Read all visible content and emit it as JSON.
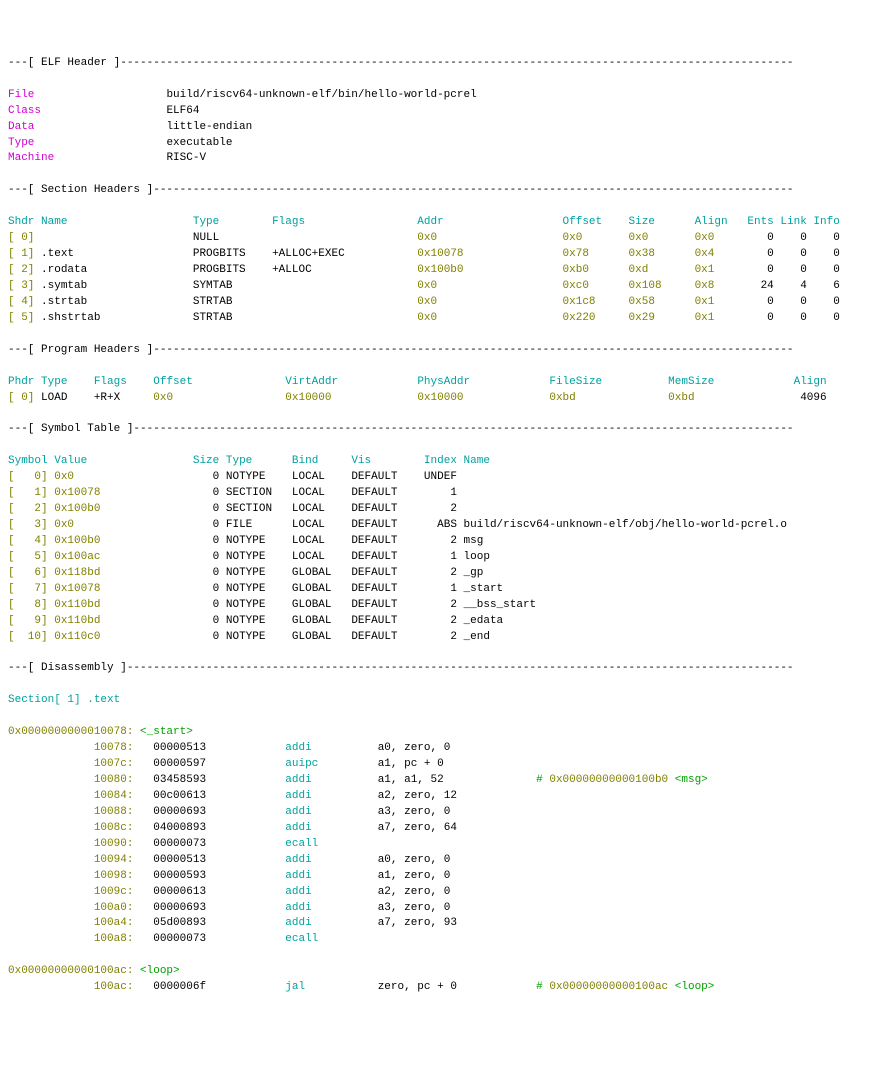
{
  "header_titles": {
    "elf": "---[ ELF Header ]------------------------------------------------------------------------------------------------------",
    "sections": "---[ Section Headers ]-------------------------------------------------------------------------------------------------",
    "programs": "---[ Program Headers ]-------------------------------------------------------------------------------------------------",
    "symbols": "---[ Symbol Table ]----------------------------------------------------------------------------------------------------",
    "disasm": "---[ Disassembly ]-----------------------------------------------------------------------------------------------------"
  },
  "elf": {
    "labels": {
      "file": "File",
      "class": "Class",
      "data": "Data",
      "type": "Type",
      "machine": "Machine"
    },
    "file": "build/riscv64-unknown-elf/bin/hello-world-pcrel",
    "class": "ELF64",
    "data": "little-endian",
    "type": "executable",
    "machine": "RISC-V"
  },
  "sections": {
    "cols": {
      "shdr": "Shdr",
      "name": "Name",
      "type": "Type",
      "flags": "Flags",
      "addr": "Addr",
      "offset": "Offset",
      "size": "Size",
      "align": "Align",
      "ents": "Ents",
      "link": "Link",
      "info": "Info"
    },
    "rows": [
      {
        "i": "[ 0]",
        "name": "",
        "type": "NULL",
        "flags": "",
        "addr": "0x0",
        "offset": "0x0",
        "size": "0x0",
        "align": "0x0",
        "ents": "0",
        "link": "0",
        "info": "0"
      },
      {
        "i": "[ 1]",
        "name": ".text",
        "type": "PROGBITS",
        "flags": "+ALLOC+EXEC",
        "addr": "0x10078",
        "offset": "0x78",
        "size": "0x38",
        "align": "0x4",
        "ents": "0",
        "link": "0",
        "info": "0"
      },
      {
        "i": "[ 2]",
        "name": ".rodata",
        "type": "PROGBITS",
        "flags": "+ALLOC",
        "addr": "0x100b0",
        "offset": "0xb0",
        "size": "0xd",
        "align": "0x1",
        "ents": "0",
        "link": "0",
        "info": "0"
      },
      {
        "i": "[ 3]",
        "name": ".symtab",
        "type": "SYMTAB",
        "flags": "",
        "addr": "0x0",
        "offset": "0xc0",
        "size": "0x108",
        "align": "0x8",
        "ents": "24",
        "link": "4",
        "info": "6"
      },
      {
        "i": "[ 4]",
        "name": ".strtab",
        "type": "STRTAB",
        "flags": "",
        "addr": "0x0",
        "offset": "0x1c8",
        "size": "0x58",
        "align": "0x1",
        "ents": "0",
        "link": "0",
        "info": "0"
      },
      {
        "i": "[ 5]",
        "name": ".shstrtab",
        "type": "STRTAB",
        "flags": "",
        "addr": "0x0",
        "offset": "0x220",
        "size": "0x29",
        "align": "0x1",
        "ents": "0",
        "link": "0",
        "info": "0"
      }
    ]
  },
  "programs": {
    "cols": {
      "phdr": "Phdr",
      "type": "Type",
      "flags": "Flags",
      "offset": "Offset",
      "vaddr": "VirtAddr",
      "paddr": "PhysAddr",
      "fsize": "FileSize",
      "msize": "MemSize",
      "align": "Align"
    },
    "rows": [
      {
        "i": "[ 0]",
        "type": "LOAD",
        "flags": "+R+X",
        "offset": "0x0",
        "vaddr": "0x10000",
        "paddr": "0x10000",
        "fsize": "0xbd",
        "msize": "0xbd",
        "align": "4096"
      }
    ]
  },
  "symbols": {
    "cols": {
      "symbol": "Symbol",
      "value": "Value",
      "size": "Size",
      "type": "Type",
      "bind": "Bind",
      "vis": "Vis",
      "index": "Index",
      "name": "Name"
    },
    "rows": [
      {
        "i": "[   0]",
        "value": "0x0",
        "size": "0",
        "type": "NOTYPE",
        "bind": "LOCAL",
        "vis": "DEFAULT",
        "index": "UNDEF",
        "name": ""
      },
      {
        "i": "[   1]",
        "value": "0x10078",
        "size": "0",
        "type": "SECTION",
        "bind": "LOCAL",
        "vis": "DEFAULT",
        "index": "1",
        "name": ""
      },
      {
        "i": "[   2]",
        "value": "0x100b0",
        "size": "0",
        "type": "SECTION",
        "bind": "LOCAL",
        "vis": "DEFAULT",
        "index": "2",
        "name": ""
      },
      {
        "i": "[   3]",
        "value": "0x0",
        "size": "0",
        "type": "FILE",
        "bind": "LOCAL",
        "vis": "DEFAULT",
        "index": "ABS",
        "name": "build/riscv64-unknown-elf/obj/hello-world-pcrel.o"
      },
      {
        "i": "[   4]",
        "value": "0x100b0",
        "size": "0",
        "type": "NOTYPE",
        "bind": "LOCAL",
        "vis": "DEFAULT",
        "index": "2",
        "name": "msg"
      },
      {
        "i": "[   5]",
        "value": "0x100ac",
        "size": "0",
        "type": "NOTYPE",
        "bind": "LOCAL",
        "vis": "DEFAULT",
        "index": "1",
        "name": "loop"
      },
      {
        "i": "[   6]",
        "value": "0x118bd",
        "size": "0",
        "type": "NOTYPE",
        "bind": "GLOBAL",
        "vis": "DEFAULT",
        "index": "2",
        "name": "_gp"
      },
      {
        "i": "[   7]",
        "value": "0x10078",
        "size": "0",
        "type": "NOTYPE",
        "bind": "GLOBAL",
        "vis": "DEFAULT",
        "index": "1",
        "name": "_start"
      },
      {
        "i": "[   8]",
        "value": "0x110bd",
        "size": "0",
        "type": "NOTYPE",
        "bind": "GLOBAL",
        "vis": "DEFAULT",
        "index": "2",
        "name": "__bss_start"
      },
      {
        "i": "[   9]",
        "value": "0x110bd",
        "size": "0",
        "type": "NOTYPE",
        "bind": "GLOBAL",
        "vis": "DEFAULT",
        "index": "2",
        "name": "_edata"
      },
      {
        "i": "[  10]",
        "value": "0x110c0",
        "size": "0",
        "type": "NOTYPE",
        "bind": "GLOBAL",
        "vis": "DEFAULT",
        "index": "2",
        "name": "_end"
      }
    ]
  },
  "disassembly": {
    "section_title": "Section[ 1] .text",
    "blocks": [
      {
        "addr": "0x0000000000010078:",
        "label": "<_start>",
        "rows": [
          {
            "pc": "10078:",
            "hex": "00000513",
            "mnem": "addi",
            "args": "a0, zero, 0",
            "cmt": ""
          },
          {
            "pc": "1007c:",
            "hex": "00000597",
            "mnem": "auipc",
            "args": "a1, pc + 0",
            "cmt": ""
          },
          {
            "pc": "10080:",
            "hex": "03458593",
            "mnem": "addi",
            "args": "a1, a1, 52",
            "cmt": "# 0x00000000000100b0 <msg>"
          },
          {
            "pc": "10084:",
            "hex": "00c00613",
            "mnem": "addi",
            "args": "a2, zero, 12",
            "cmt": ""
          },
          {
            "pc": "10088:",
            "hex": "00000693",
            "mnem": "addi",
            "args": "a3, zero, 0",
            "cmt": ""
          },
          {
            "pc": "1008c:",
            "hex": "04000893",
            "mnem": "addi",
            "args": "a7, zero, 64",
            "cmt": ""
          },
          {
            "pc": "10090:",
            "hex": "00000073",
            "mnem": "ecall",
            "args": "",
            "cmt": ""
          },
          {
            "pc": "10094:",
            "hex": "00000513",
            "mnem": "addi",
            "args": "a0, zero, 0",
            "cmt": ""
          },
          {
            "pc": "10098:",
            "hex": "00000593",
            "mnem": "addi",
            "args": "a1, zero, 0",
            "cmt": ""
          },
          {
            "pc": "1009c:",
            "hex": "00000613",
            "mnem": "addi",
            "args": "a2, zero, 0",
            "cmt": ""
          },
          {
            "pc": "100a0:",
            "hex": "00000693",
            "mnem": "addi",
            "args": "a3, zero, 0",
            "cmt": ""
          },
          {
            "pc": "100a4:",
            "hex": "05d00893",
            "mnem": "addi",
            "args": "a7, zero, 93",
            "cmt": ""
          },
          {
            "pc": "100a8:",
            "hex": "00000073",
            "mnem": "ecall",
            "args": "",
            "cmt": ""
          }
        ]
      },
      {
        "addr": "0x00000000000100ac:",
        "label": "<loop>",
        "rows": [
          {
            "pc": "100ac:",
            "hex": "0000006f",
            "mnem": "jal",
            "args": "zero, pc + 0",
            "cmt": "# 0x00000000000100ac <loop>"
          }
        ]
      }
    ]
  }
}
